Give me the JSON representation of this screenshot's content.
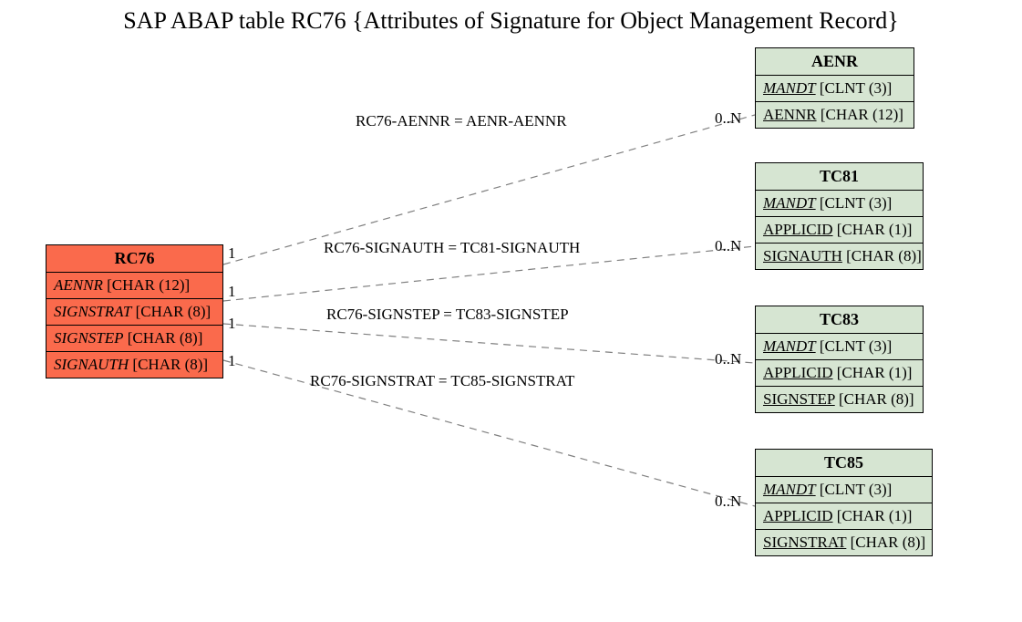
{
  "title": "SAP ABAP table RC76 {Attributes of Signature for Object Management Record}",
  "entities": {
    "rc76": {
      "name": "RC76",
      "fields": [
        {
          "fn": "AENNR",
          "type": "[CHAR (12)]"
        },
        {
          "fn": "SIGNSTRAT",
          "type": "[CHAR (8)]"
        },
        {
          "fn": "SIGNSTEP",
          "type": "[CHAR (8)]"
        },
        {
          "fn": "SIGNAUTH",
          "type": "[CHAR (8)]"
        }
      ]
    },
    "aenr": {
      "name": "AENR",
      "fields": [
        {
          "fn": "MANDT",
          "type": "[CLNT (3)]",
          "ul": true
        },
        {
          "fn": "AENNR",
          "type": "[CHAR (12)]",
          "ul": true
        }
      ]
    },
    "tc81": {
      "name": "TC81",
      "fields": [
        {
          "fn": "MANDT",
          "type": "[CLNT (3)]",
          "ul": true
        },
        {
          "fn": "APPLICID",
          "type": "[CHAR (1)]",
          "ul": true
        },
        {
          "fn": "SIGNAUTH",
          "type": "[CHAR (8)]",
          "ul": true
        }
      ]
    },
    "tc83": {
      "name": "TC83",
      "fields": [
        {
          "fn": "MANDT",
          "type": "[CLNT (3)]",
          "ul": true
        },
        {
          "fn": "APPLICID",
          "type": "[CHAR (1)]",
          "ul": true
        },
        {
          "fn": "SIGNSTEP",
          "type": "[CHAR (8)]",
          "ul": true
        }
      ]
    },
    "tc85": {
      "name": "TC85",
      "fields": [
        {
          "fn": "MANDT",
          "type": "[CLNT (3)]",
          "ul": true
        },
        {
          "fn": "APPLICID",
          "type": "[CHAR (1)]",
          "ul": true
        },
        {
          "fn": "SIGNSTRAT",
          "type": "[CHAR (8)]",
          "ul": true
        }
      ]
    }
  },
  "edges": {
    "e1": {
      "label": "RC76-AENNR = AENR-AENNR",
      "left_card": "1",
      "right_card": "0..N"
    },
    "e2": {
      "label": "RC76-SIGNAUTH = TC81-SIGNAUTH",
      "left_card": "1",
      "right_card": "0..N"
    },
    "e3": {
      "label": "RC76-SIGNSTEP = TC83-SIGNSTEP",
      "left_card": "1",
      "right_card": "0..N"
    },
    "e4": {
      "label": "RC76-SIGNSTRAT = TC85-SIGNSTRAT",
      "left_card": "1",
      "right_card": "0..N"
    }
  }
}
